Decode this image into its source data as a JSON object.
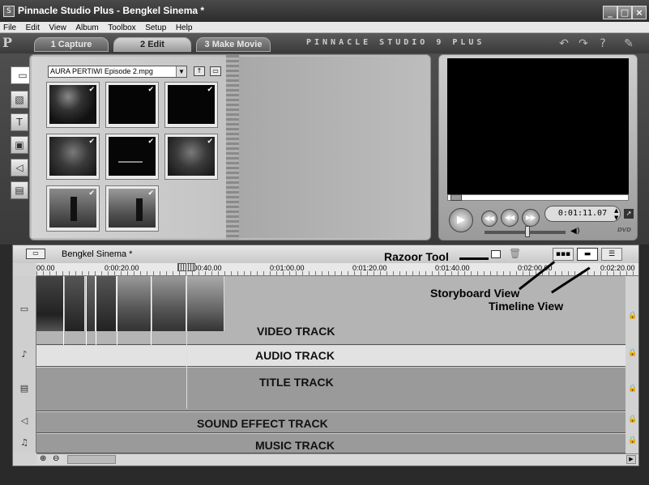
{
  "window": {
    "title": "Pinnacle Studio Plus - Bengkel Sinema *",
    "icon_text": "S",
    "minimize": "_",
    "maximize": "□",
    "close": "×"
  },
  "menu": [
    "File",
    "Edit",
    "View",
    "Album",
    "Toolbox",
    "Setup",
    "Help"
  ],
  "tabs": [
    {
      "label": "1 Capture",
      "active": false
    },
    {
      "label": "2 Edit",
      "active": true
    },
    {
      "label": "3 Make Movie",
      "active": false
    }
  ],
  "brand": "PINNACLE STUDIO 9 PLUS",
  "toolbar_icons": [
    "undo-icon",
    "redo-icon",
    "help-icon",
    "toolbox-icon"
  ],
  "album": {
    "selected_file": "AURA PERTIWI Episode 2.mpg",
    "sidetools": [
      "video-scenes-icon",
      "transitions-icon",
      "titles-icon",
      "still-images-icon",
      "sound-effects-icon",
      "disc-menus-icon"
    ],
    "thumbnails": [
      {
        "tone": "stage"
      },
      {
        "tone": "dark"
      },
      {
        "tone": "dark"
      },
      {
        "tone": "smoky"
      },
      {
        "tone": "dark-text"
      },
      {
        "tone": "smoky"
      },
      {
        "tone": "girl-room"
      },
      {
        "tone": "girl-room"
      }
    ]
  },
  "player": {
    "counter": "0:01:11.07",
    "logo": "DVD"
  },
  "movie": {
    "project_title": "Bengkel Sinema *",
    "ruler_labels": [
      "00.00",
      "0:00:20.00",
      "0:00:40.00",
      "0:01:00.00",
      "0:01:20.00",
      "0:01:40.00",
      "0:02:00.00",
      "0:02:20.00"
    ],
    "tracks": {
      "video": "VIDEO TRACK",
      "audio": "AUDIO TRACK",
      "title": "TITLE TRACK",
      "sound_effect": "SOUND EFFECT TRACK",
      "music": "MUSIC TRACK"
    }
  },
  "annotations": {
    "razor": "Razoor Tool",
    "storyboard": "Storyboard View",
    "timeline": "Timeline View"
  }
}
